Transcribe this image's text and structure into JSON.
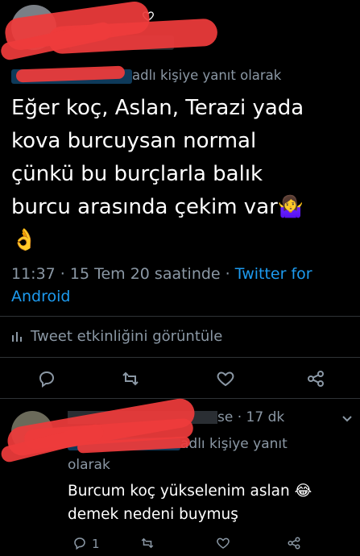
{
  "main_tweet": {
    "reply_prefix": "adlı kişiye yanıt olarak",
    "text_line1": "Eğer koç, Aslan, Terazi yada",
    "text_line2": "kova burcuysan normal",
    "text_line3": "çünkü bu burçlarla balık",
    "text_line4": "burcu arasında çekim var",
    "emoji_shrug": "🤷‍♀️",
    "emoji_ok": "👌",
    "time": "11:37 · 15 Tem 20 saatinde · ",
    "client_line1": "Twitter for",
    "client_line2": "Android",
    "activity_label": "Tweet etkinliğini görüntüle",
    "icons": [
      "reply-icon",
      "retweet-icon",
      "like-icon",
      "share-icon"
    ]
  },
  "reply_tweet": {
    "name_fragment": "se · 17 dk",
    "reply_prefix_fragment": "adlı kişiye yanıt",
    "reply_prefix_line2": "olarak",
    "text_line1": "Burcum koç yükselenim aslan",
    "emoji_laugh": "😂",
    "text_line2": "demek nedeni buymuş",
    "reply_count": "1",
    "icons": [
      "reply-icon",
      "retweet-icon",
      "like-icon",
      "share-icon"
    ]
  },
  "colors": {
    "background": "#000000",
    "text": "#ffffff",
    "muted": "#8b98a5",
    "link": "#1d9bf0",
    "redaction": "#ee3b3b"
  }
}
